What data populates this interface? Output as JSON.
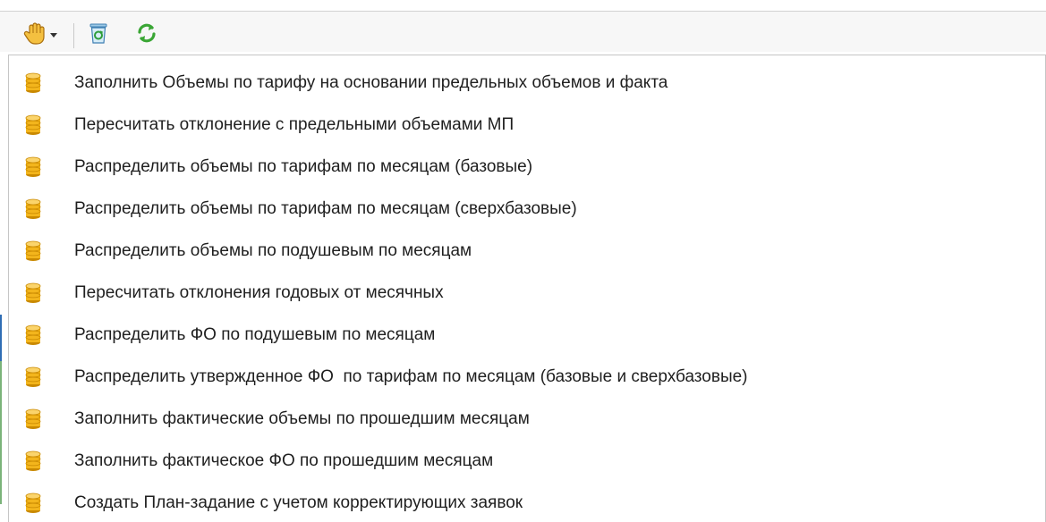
{
  "toolbar": {
    "hand_icon": "hand-icon",
    "dropdown_icon": "chevron-down-icon",
    "trash_icon": "recycle-bin-icon",
    "refresh_icon": "refresh-icon"
  },
  "menu": {
    "items": [
      {
        "label": "Заполнить Объемы по тарифу на основании предельных объемов и факта",
        "icon": "database-icon"
      },
      {
        "label": "Пересчитать отклонение с предельными объемами МП",
        "icon": "database-icon"
      },
      {
        "label": "Распределить объемы по тарифам по месяцам (базовые)",
        "icon": "database-icon"
      },
      {
        "label": "Распределить объемы по тарифам по месяцам (сверхбазовые)",
        "icon": "database-icon"
      },
      {
        "label": "Распределить объемы по подушевым по месяцам",
        "icon": "database-icon"
      },
      {
        "label": "Пересчитать отклонения годовых от месячных",
        "icon": "database-icon"
      },
      {
        "label": "Распределить ФО по подушевым по месяцам",
        "icon": "database-icon"
      },
      {
        "label": "Распределить утвержденное ФО  по тарифам по месяцам (базовые и сверхбазовые)",
        "icon": "database-icon"
      },
      {
        "label": "Заполнить фактические объемы по прошедшим месяцам",
        "icon": "database-icon"
      },
      {
        "label": "Заполнить фактическое ФО по прошедшим месяцам",
        "icon": "database-icon"
      },
      {
        "label": "Создать План-задание с учетом корректирующих заявок",
        "icon": "database-icon"
      }
    ]
  },
  "colors": {
    "db_gold": "#f3b51c",
    "db_gold_dark": "#c98900",
    "refresh_green": "#3aa635",
    "menu_border": "#c6c6c6"
  }
}
